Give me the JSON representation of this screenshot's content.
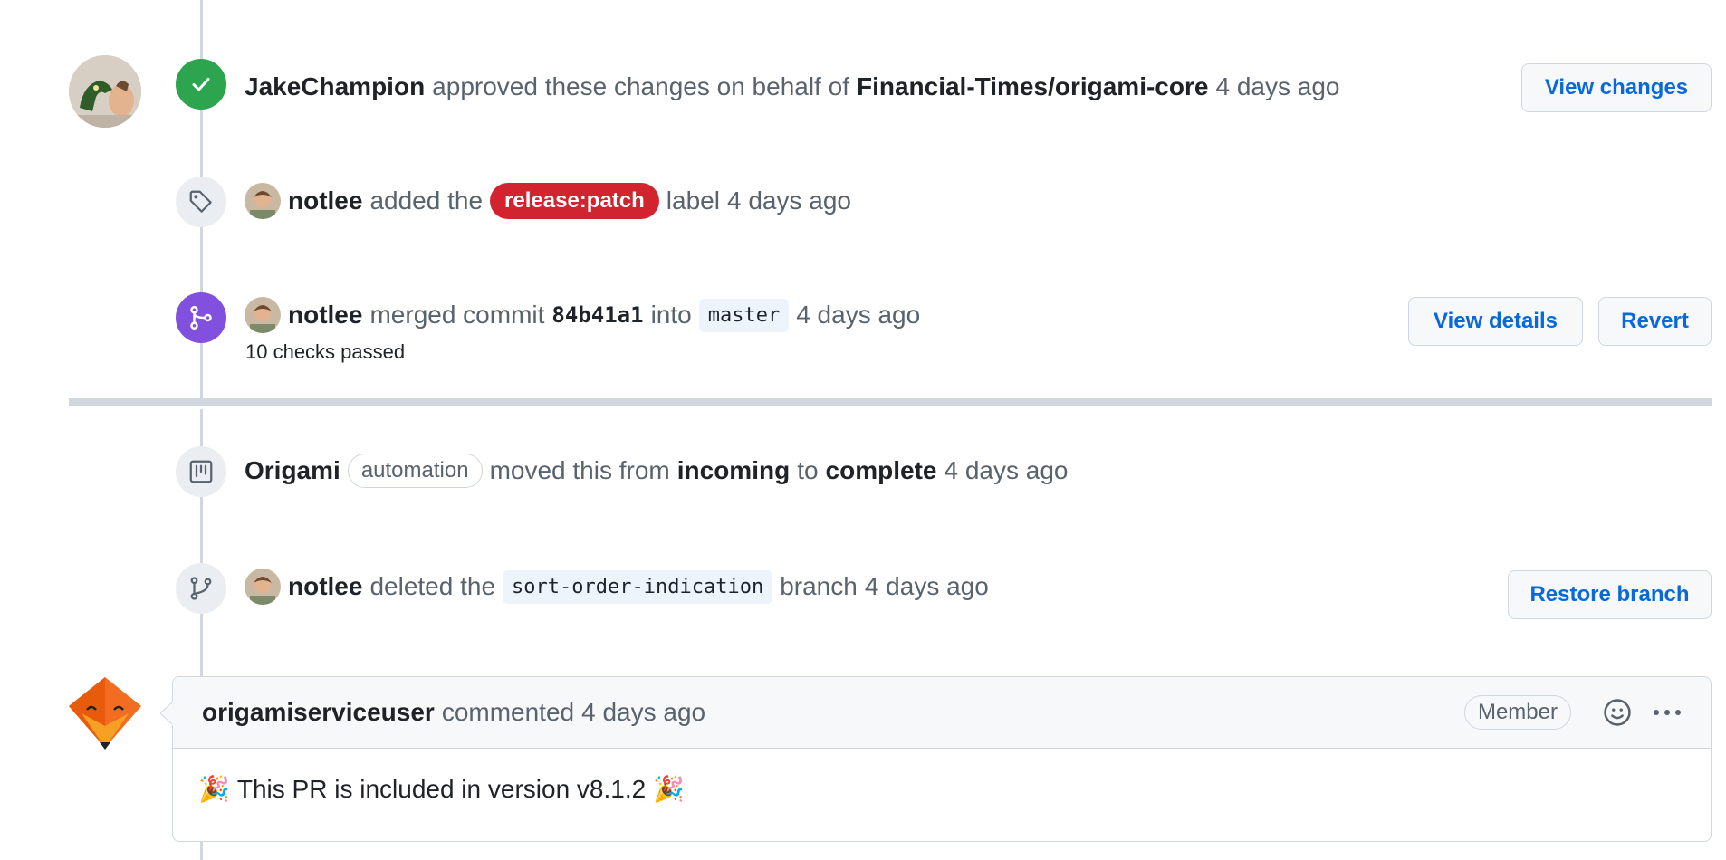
{
  "review": {
    "author": "JakeChampion",
    "action": "approved these changes on behalf of",
    "org": "Financial-Times/origami-core",
    "time": "4 days ago",
    "view_changes": "View changes"
  },
  "label_event": {
    "author": "notlee",
    "action": "added the",
    "label": "release:patch",
    "suffix": "label",
    "time": "4 days ago"
  },
  "merge_event": {
    "author": "notlee",
    "action": "merged commit",
    "commit": "84b41a1",
    "into": "into",
    "branch": "master",
    "time": "4 days ago",
    "checks": "10 checks passed",
    "view_details": "View details",
    "revert": "Revert"
  },
  "project_event": {
    "project": "Origami",
    "badge": "automation",
    "action": "moved this from",
    "from": "incoming",
    "to_word": "to",
    "to": "complete",
    "time": "4 days ago"
  },
  "delete_event": {
    "author": "notlee",
    "action": "deleted the",
    "branch": "sort-order-indication",
    "suffix": "branch",
    "time": "4 days ago",
    "restore": "Restore branch"
  },
  "comment": {
    "author": "origamiserviceuser",
    "action": "commented",
    "time": "4 days ago",
    "role": "Member",
    "emoji": "🎉",
    "body": "This PR is included in version v8.1.2"
  },
  "colors": {
    "approve": "#2da44e",
    "merge": "#8250df",
    "label_red": "#d1242f",
    "link": "#0969da"
  }
}
